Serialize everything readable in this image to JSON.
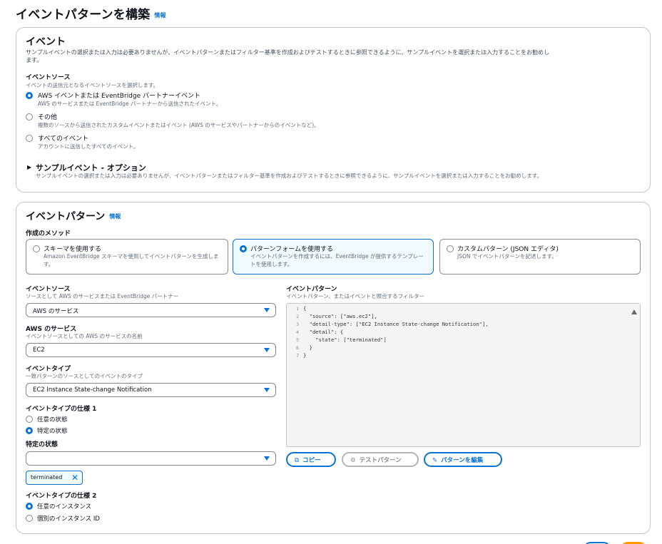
{
  "page": {
    "title": "イベントパターンを構築",
    "info_link": "情報"
  },
  "event_section": {
    "title": "イベント",
    "description": "サンプルイベントの選択または入力は必要ありませんが、イベントパターンまたはフィルター基準を作成およびテストするときに参照できるように、サンプルイベントを選択または入力することをお勧めし",
    "description2": "ます。",
    "source_label": "イベントソース",
    "source_desc": "イベントの送信元となるイベントソースを選択します。",
    "options": [
      {
        "title": "AWS イベントまたは EventBridge パートナーイベント",
        "desc": "AWS のサービスまたは EventBridge パートナーから送信されたイベント。",
        "selected": true
      },
      {
        "title": "その他",
        "desc": "複数のソースから送信されたカスタムイベントまたはイベント (AWS のサービスやパートナーからのイベントなど)。",
        "selected": false
      },
      {
        "title": "すべてのイベント",
        "desc": "アカウントに送信したすべてのイベント。",
        "selected": false
      }
    ],
    "sample_title": "サンプルイベント - オプション",
    "sample_desc": "サンプルイベントの選択または入力は必要ありませんが、イベントパターンまたはフィルター基準を作成およびテストするときに参照できるように、サンプルイベントを選択または入力することをお勧めします。"
  },
  "pattern_section": {
    "title": "イベントパターン",
    "info_link": "情報",
    "method_label": "作成のメソッド",
    "methods": [
      {
        "title": "スキーマを使用する",
        "desc": "Amazon EventBridge スキーマを使用してイベントパターンを生成します。",
        "selected": false
      },
      {
        "title": "パターンフォームを使用する",
        "desc": "イベントパターンを作成するには、EventBridge が提供するテンプレートを使用します。",
        "selected": true
      },
      {
        "title": "カスタムパターン (JSON エディタ)",
        "desc": "JSON でイベントパターンを記述します。",
        "selected": false
      }
    ],
    "event_source": {
      "label": "イベントソース",
      "desc": "ソースとして AWS のサービスまたは EventBridge パートナー",
      "value": "AWS のサービス"
    },
    "aws_service": {
      "label": "AWS のサービス",
      "desc": "イベントソースとしての AWS のサービスの名前",
      "value": "EC2"
    },
    "event_type": {
      "label": "イベントタイプ",
      "desc": "一致パターンのソースとしてのイベントのタイプ",
      "value": "EC2 Instance State-change Notification"
    },
    "spec1": {
      "label": "イベントタイプの仕様 1",
      "options": [
        {
          "label": "任意の状態",
          "selected": false
        },
        {
          "label": "特定の状態",
          "selected": true
        }
      ]
    },
    "specific_state": {
      "label": "特定の状態",
      "value": "",
      "token": "terminated"
    },
    "spec2": {
      "label": "イベントタイプの仕様 2",
      "options": [
        {
          "label": "任意のインスタンス",
          "selected": true
        },
        {
          "label": "個別のインスタンス ID",
          "selected": false
        }
      ]
    },
    "editor": {
      "label": "イベントパターン",
      "desc": "イベントパターン、またはイベントと照合するフィルター",
      "line_numbers": [
        "1",
        "2",
        "3",
        "4",
        "5",
        "6",
        "7"
      ],
      "lines": [
        "{",
        "  \"source\": [\"aws.ec2\"],",
        "  \"detail-type\": [\"EC2 Instance State-change Notification\"],",
        "  \"detail\": {",
        "    \"state\": [\"terminated\"]",
        "  }",
        "}"
      ]
    },
    "buttons": {
      "copy": "コピー",
      "test": "テストパターン",
      "edit": "パターンを編集"
    }
  },
  "colors": {
    "accent": "#0972d3",
    "selected_bg": "#f0fbff",
    "border": "#c6c6cd",
    "footer_primary": "#ff9900"
  },
  "icons": {
    "copy": "copy-icon",
    "test": "gear-icon",
    "edit": "pencil-icon",
    "remove": "close-icon",
    "caret": "caret-down-icon",
    "collapse": "triangle-right-icon"
  }
}
